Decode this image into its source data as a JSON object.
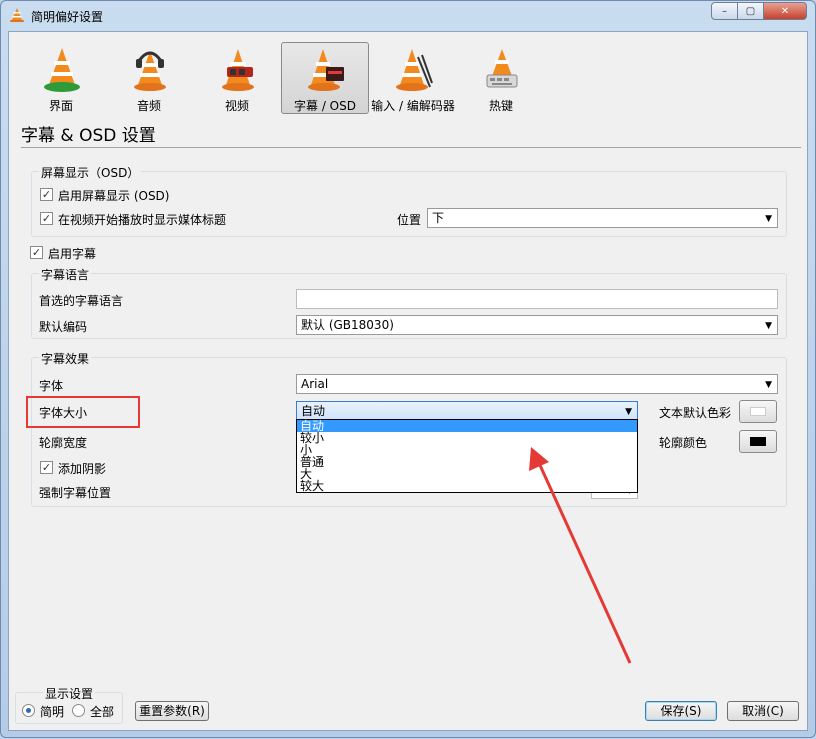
{
  "window": {
    "title": "简明偏好设置",
    "buttons": {
      "min": "–",
      "max": "▢",
      "close": "✕"
    }
  },
  "toolbar": {
    "items": [
      {
        "label": "界面"
      },
      {
        "label": "音频"
      },
      {
        "label": "视频"
      },
      {
        "label": "字幕 / OSD",
        "active": true
      },
      {
        "label": "输入 / 编解码器"
      },
      {
        "label": "热键"
      }
    ]
  },
  "page": {
    "title": "字幕 & OSD 设置"
  },
  "osd": {
    "group_title": "屏幕显示（OSD）",
    "enable_osd": {
      "label": "启用屏幕显示 (OSD)",
      "checked": true
    },
    "show_title": {
      "label": "在视频开始播放时显示媒体标题",
      "checked": true
    },
    "position_label": "位置",
    "position_value": "下"
  },
  "subtitles": {
    "enable": {
      "label": "启用字幕",
      "checked": true
    },
    "language_group": "字幕语言",
    "preferred_lang_label": "首选的字幕语言",
    "preferred_lang_value": "",
    "encoding_label": "默认编码",
    "encoding_value": "默认 (GB18030)"
  },
  "effects": {
    "group_title": "字幕效果",
    "font_label": "字体",
    "font_value": "Arial",
    "font_size_label": "字体大小",
    "font_size_value": "自动",
    "font_size_options": [
      "自动",
      "较小",
      "小",
      "普通",
      "大",
      "较大"
    ],
    "outline_label": "轮廓宽度",
    "shadow": {
      "label": "添加阴影",
      "checked": true
    },
    "force_position_label": "强制字幕位置",
    "text_color_label": "文本默认色彩",
    "outline_color_label": "轮廓颜色",
    "text_color": "#ffffff",
    "outline_color": "#000000"
  },
  "footer": {
    "show_settings_group": "显示设置",
    "simple_label": "简明",
    "all_label": "全部",
    "reset_label": "重置参数(R)",
    "save_label": "保存(S)",
    "cancel_label": "取消(C)"
  },
  "colors": {
    "highlight": "#e53935",
    "selection": "#3399ff"
  }
}
